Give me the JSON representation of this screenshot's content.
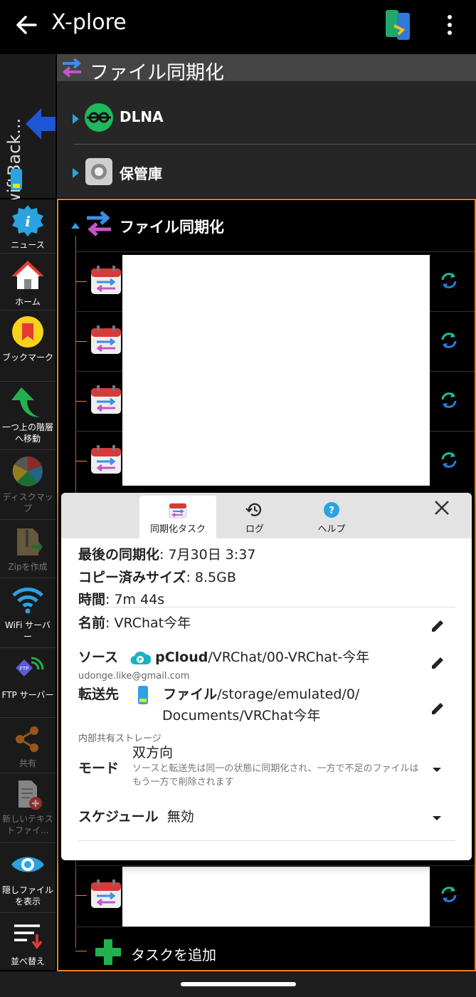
{
  "appbar": {
    "title": "X-plore"
  },
  "left_pane": {
    "label": "SwiftBack..."
  },
  "upper_panel": {
    "header": "ファイル同期化",
    "items": [
      {
        "label": "DLNA"
      },
      {
        "label": "保管庫"
      }
    ]
  },
  "toolbar": {
    "items": [
      {
        "label": "ニュース"
      },
      {
        "label": "ホーム"
      },
      {
        "label": "ブックマーク"
      },
      {
        "label": "一つ上の階層へ移動"
      },
      {
        "label": "ディスクマップ"
      },
      {
        "label": "Zipを作成"
      },
      {
        "label": "WiFi サーバー"
      },
      {
        "label": "FTP サーバー"
      },
      {
        "label": "共有"
      },
      {
        "label": "新しいテキストファイ..."
      },
      {
        "label": "隠しファイルを表示"
      },
      {
        "label": "並べ替え"
      }
    ]
  },
  "main": {
    "root": "ファイル同期化",
    "add_task": "タスクを追加"
  },
  "dialog": {
    "tabs": [
      {
        "label": "同期化タスク"
      },
      {
        "label": "ログ"
      },
      {
        "label": "ヘルプ"
      }
    ],
    "last_sync_label": "最後の同期化",
    "last_sync_value": "7月30日 3:37",
    "copied_label": "コピー済みサイズ",
    "copied_value": "8.5GB",
    "time_label": "時間",
    "time_value": "7m 44s",
    "name_label": "名前",
    "name_value": "VRChat今年",
    "source_label": "ソース",
    "source_service": "pCloud",
    "source_path": "/VRChat/00-VRChat-今年",
    "source_account": "udonge.like@gmail.com",
    "dest_label": "転送先",
    "dest_service": "ファイル",
    "dest_path1": "/storage/emulated/0/",
    "dest_path2": "Documents/VRChat今年",
    "dest_storage": "内部共有ストレージ",
    "mode_label": "モード",
    "mode_value": "双方向",
    "mode_desc": "ソースと転送先は同一の状態に同期化され、一方で不足のファイルはもう一方で削除されます",
    "schedule_label": "スケジュール",
    "schedule_value": "無効"
  },
  "colors": {
    "accent_orange": "#e8801f",
    "sync_green": "#1fb89a",
    "link_blue": "#2aa3e0"
  }
}
